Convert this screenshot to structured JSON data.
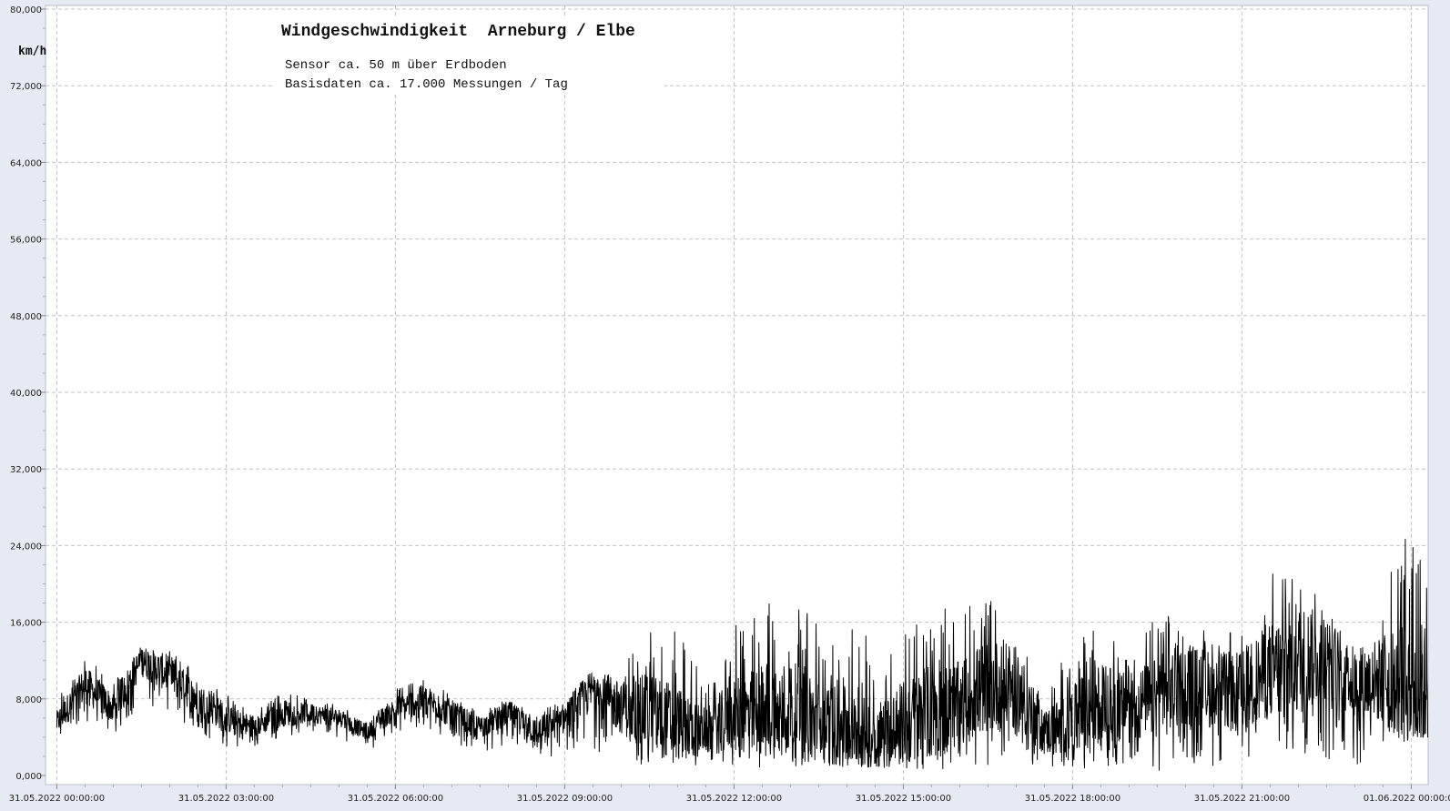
{
  "chart_data": {
    "type": "line",
    "title": "Windgeschwindigkeit  Arneburg / Elbe",
    "subtitle_lines": [
      "Sensor ca. 50 m über Erdboden",
      "Basisdaten ca. 17.000 Messungen / Tag"
    ],
    "ylabel": "km/h",
    "ylim": [
      0,
      80
    ],
    "y_ticks": [
      0,
      8,
      16,
      24,
      32,
      40,
      48,
      56,
      64,
      72,
      80
    ],
    "y_tick_labels": [
      "0,000",
      "8,000",
      "16,000",
      "24,000",
      "32,000",
      "40,000",
      "48,000",
      "56,000",
      "64,000",
      "72,000",
      "80,000"
    ],
    "xlim_hours": [
      -0.2,
      24.3
    ],
    "x_ticks_hours": [
      0,
      3,
      6,
      9,
      12,
      15,
      18,
      21,
      24
    ],
    "x_tick_labels": [
      "31.05.2022  00:00:00",
      "31.05.2022  03:00:00",
      "31.05.2022  06:00:00",
      "31.05.2022  09:00:00",
      "31.05.2022  12:00:00",
      "31.05.2022  15:00:00",
      "31.05.2022  18:00:00",
      "31.05.2022  21:00:00",
      "01.06.2022  00:00:00"
    ],
    "grid": true,
    "line_color": "#000000",
    "series": [
      {
        "sample_interval_hours": 0.5,
        "values": [
          5.5,
          9.5,
          7.0,
          12.0,
          10.5,
          8.0,
          6.0,
          5.0,
          6.5,
          6.5,
          6.0,
          4.5,
          7.0,
          8.0,
          6.5,
          5.0,
          6.5,
          4.5,
          6.0,
          9.0,
          7.0,
          6.5,
          5.5,
          4.5,
          6.5,
          6.5,
          7.0,
          5.5,
          5.0,
          4.0,
          5.5,
          6.5,
          7.5,
          9.5,
          9.0,
          4.5,
          5.5,
          7.5,
          7.0,
          8.0,
          9.5,
          9.0,
          8.5,
          11.0,
          12.0,
          12.5,
          9.5,
          10.0,
          9.0
        ]
      }
    ],
    "envelope_max": {
      "sample_interval_hours": 0.5,
      "values": [
        8.0,
        12.5,
        10.0,
        13.5,
        13.0,
        11.0,
        8.5,
        6.5,
        9.0,
        8.0,
        7.5,
        5.5,
        9.0,
        10.5,
        8.5,
        6.5,
        8.0,
        6.5,
        8.0,
        11.0,
        11.0,
        16.5,
        15.5,
        9.5,
        15.5,
        18.0,
        19.5,
        17.0,
        16.0,
        14.0,
        16.5,
        19.0,
        17.0,
        19.5,
        16.5,
        9.0,
        15.0,
        16.5,
        14.0,
        16.5,
        17.0,
        15.5,
        17.0,
        21.0,
        23.5,
        17.0,
        14.0,
        18.0,
        29.5
      ]
    },
    "envelope_min": {
      "sample_interval_hours": 0.5,
      "values": [
        3.5,
        5.5,
        4.0,
        7.5,
        6.0,
        4.5,
        3.0,
        3.0,
        4.0,
        4.5,
        4.0,
        2.5,
        4.5,
        5.0,
        3.5,
        2.5,
        3.0,
        1.5,
        2.0,
        2.5,
        1.5,
        1.0,
        1.0,
        1.0,
        1.0,
        0.5,
        1.0,
        1.0,
        0.5,
        1.0,
        0.5,
        0.5,
        1.0,
        1.0,
        1.0,
        0.5,
        1.0,
        0.5,
        1.0,
        0.5,
        1.0,
        1.0,
        1.0,
        2.5,
        2.0,
        1.0,
        0.0,
        1.5,
        4.0
      ]
    }
  }
}
